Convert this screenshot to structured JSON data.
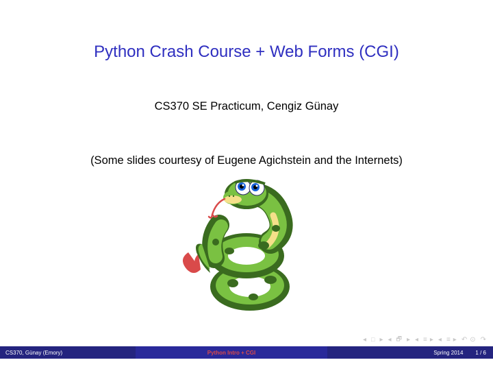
{
  "title": "Python Crash Course + Web Forms (CGI)",
  "subtitle": "CS370 SE Practicum, Cengiz Günay",
  "credits": "(Some slides courtesy of Eugene Agichstein and the Internets)",
  "footer": {
    "author": "CS370, Günay (Emory)",
    "short_title": "Python Intro + CGI",
    "term": "Spring 2014",
    "page": "1 / 6"
  }
}
